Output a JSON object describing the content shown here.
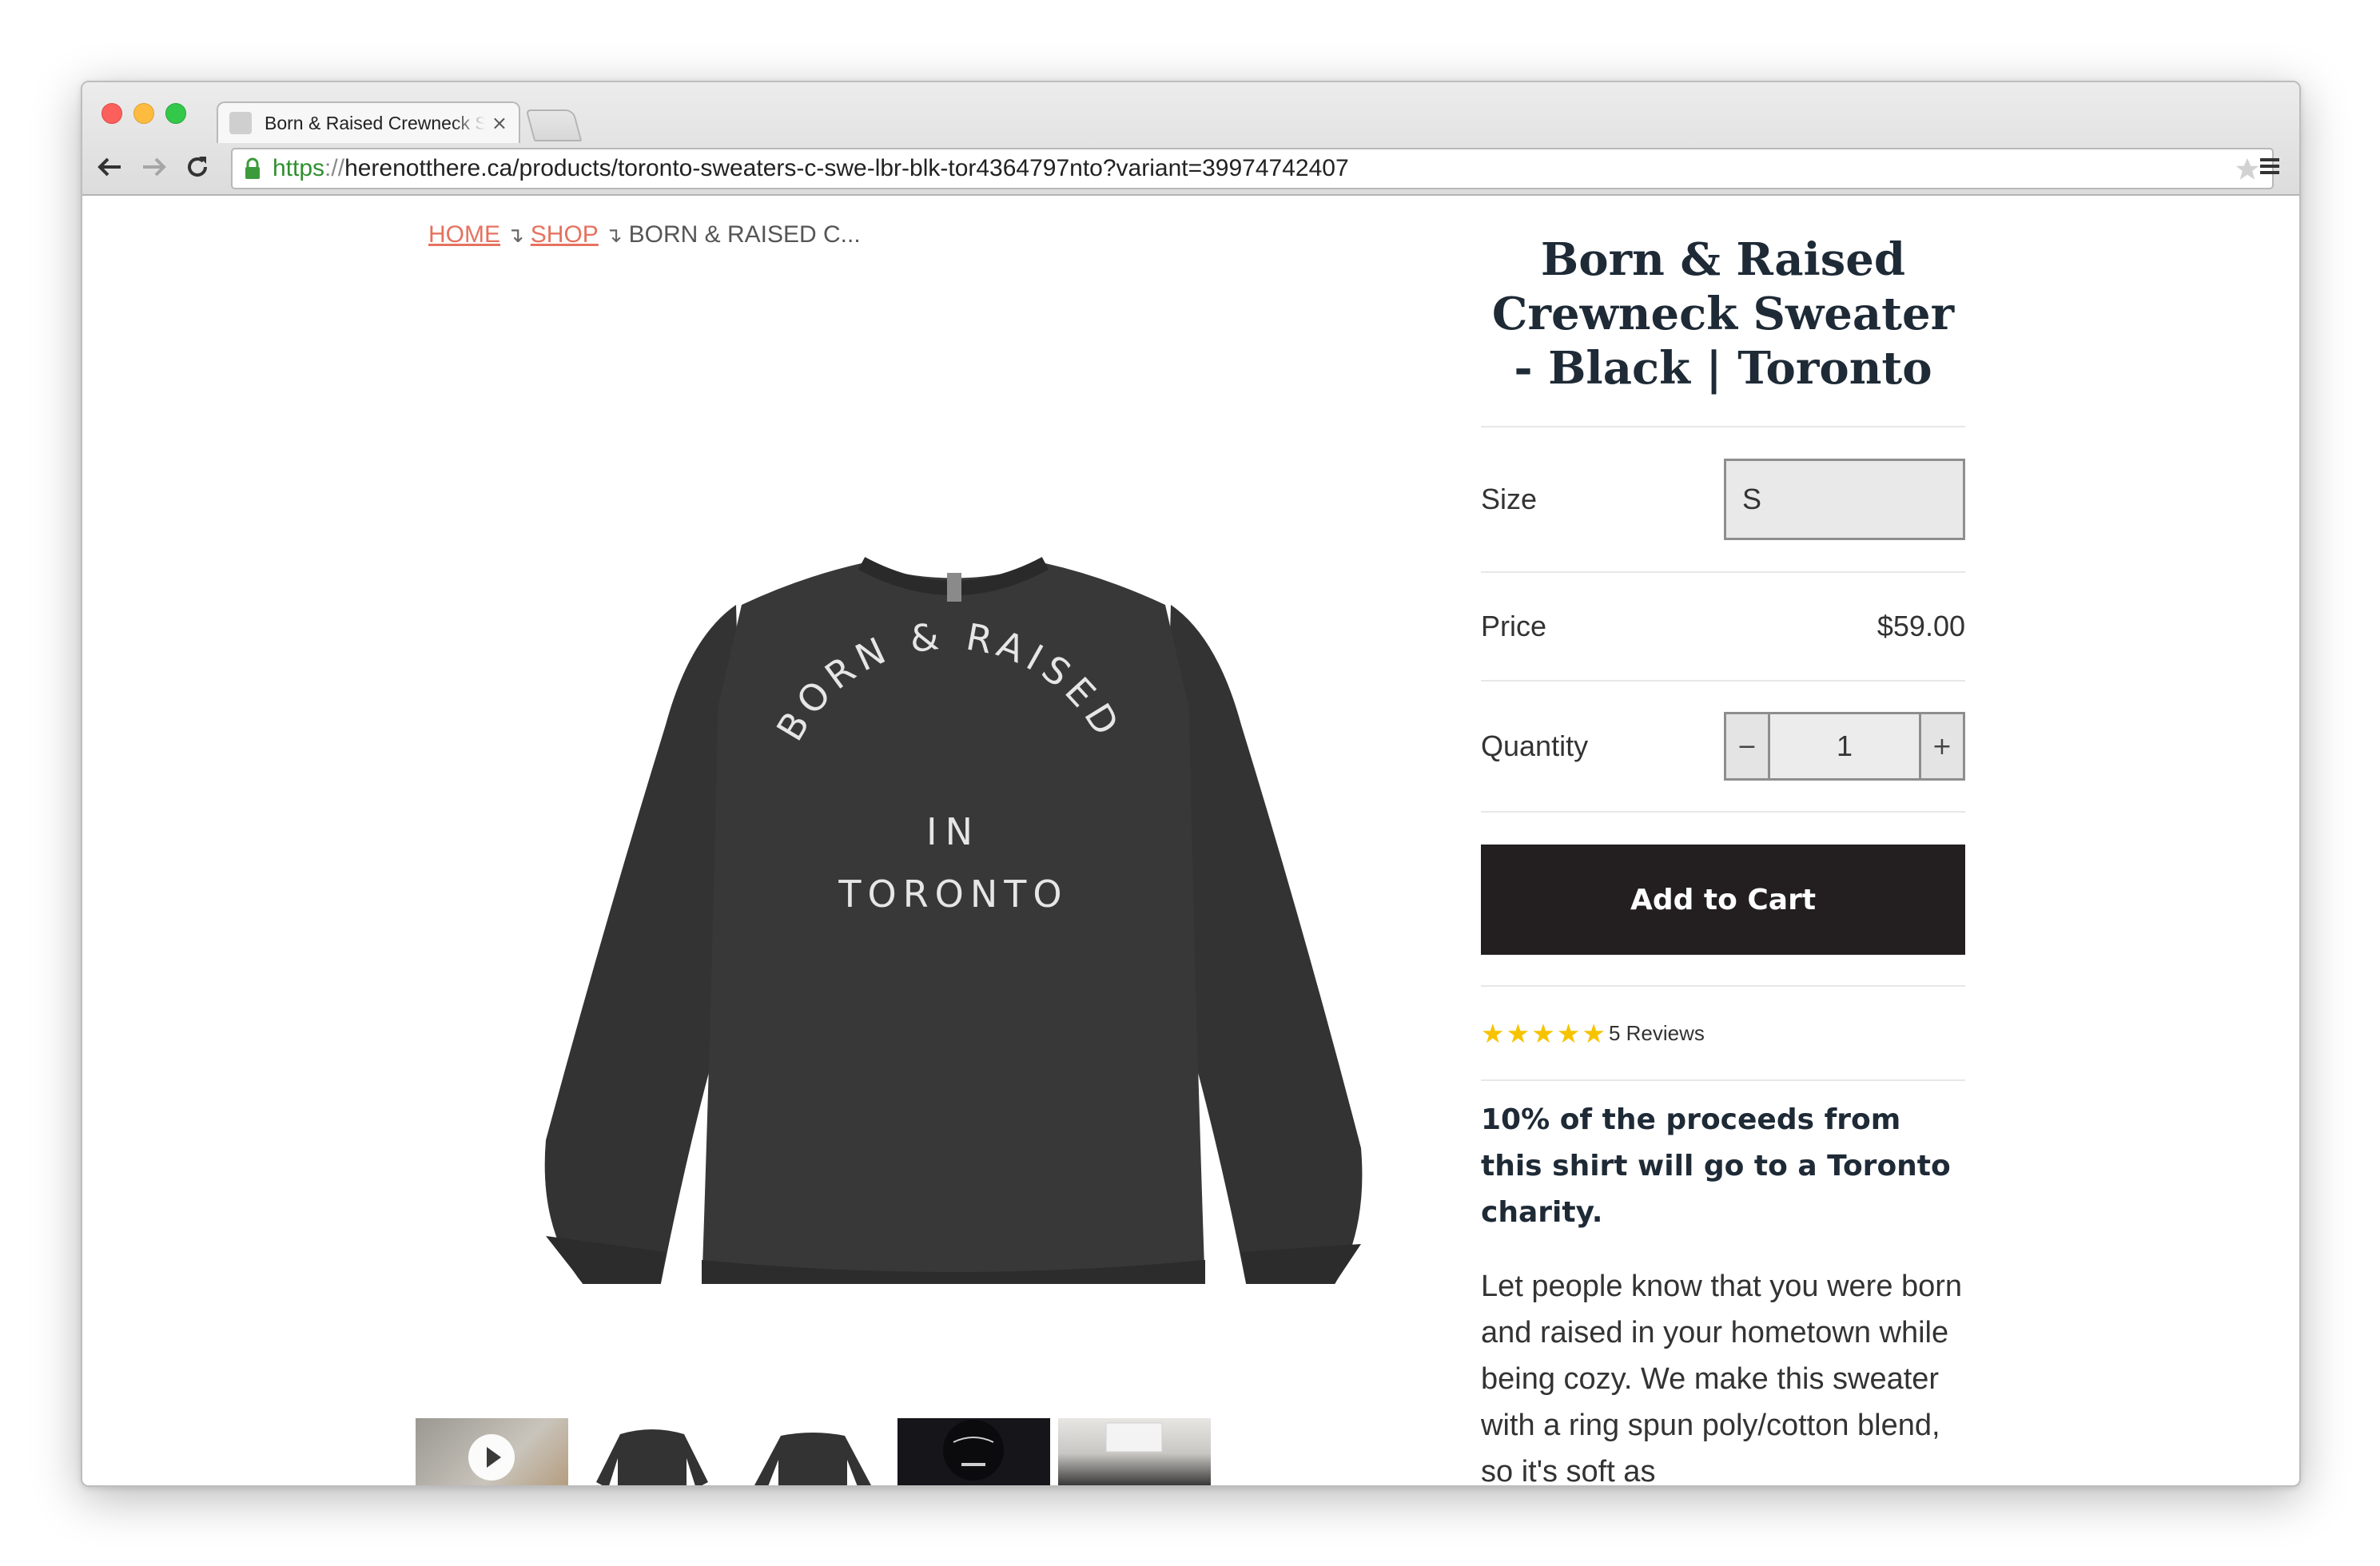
{
  "browser": {
    "tab_title": "Born & Raised Crewneck Sweater - Black | Toronto",
    "tab_close": "×",
    "url_scheme": "https",
    "url_separator": "://",
    "url_rest": "herenotthere.ca/products/toronto-sweaters-c-swe-lbr-blk-tor4364797nto?variant=39974742407"
  },
  "breadcrumb": {
    "home": "HOME",
    "shop": "SHOP",
    "current": "BORN & RAISED C...",
    "separator": "↴"
  },
  "product": {
    "image_text": {
      "arc": "BORN & RAISED",
      "middle": "IN",
      "bottom": "TORONTO"
    },
    "thumbnails": [
      "video",
      "front",
      "back",
      "model",
      "folded"
    ],
    "title": "Born & Raised Crewneck Sweater - Black | Toronto",
    "size_label": "Size",
    "size_value": "S",
    "price_label": "Price",
    "price_value": "$59.00",
    "quantity_label": "Quantity",
    "quantity_value": "1",
    "quantity_minus": "−",
    "quantity_plus": "+",
    "add_to_cart": "Add to Cart",
    "rating_stars": 5,
    "reviews_text": "5 Reviews",
    "charity_text": "10% of the proceeds from this shirt will go to a Toronto charity.",
    "description": "Let people know that you were born and raised in your hometown while being cozy. We make this sweater with a ring spun poly/cotton blend, so it's soft as"
  },
  "colors": {
    "accent_link": "#e5725f",
    "title": "#1e2a36",
    "cart_button": "#231f20",
    "star": "#f7c300"
  }
}
